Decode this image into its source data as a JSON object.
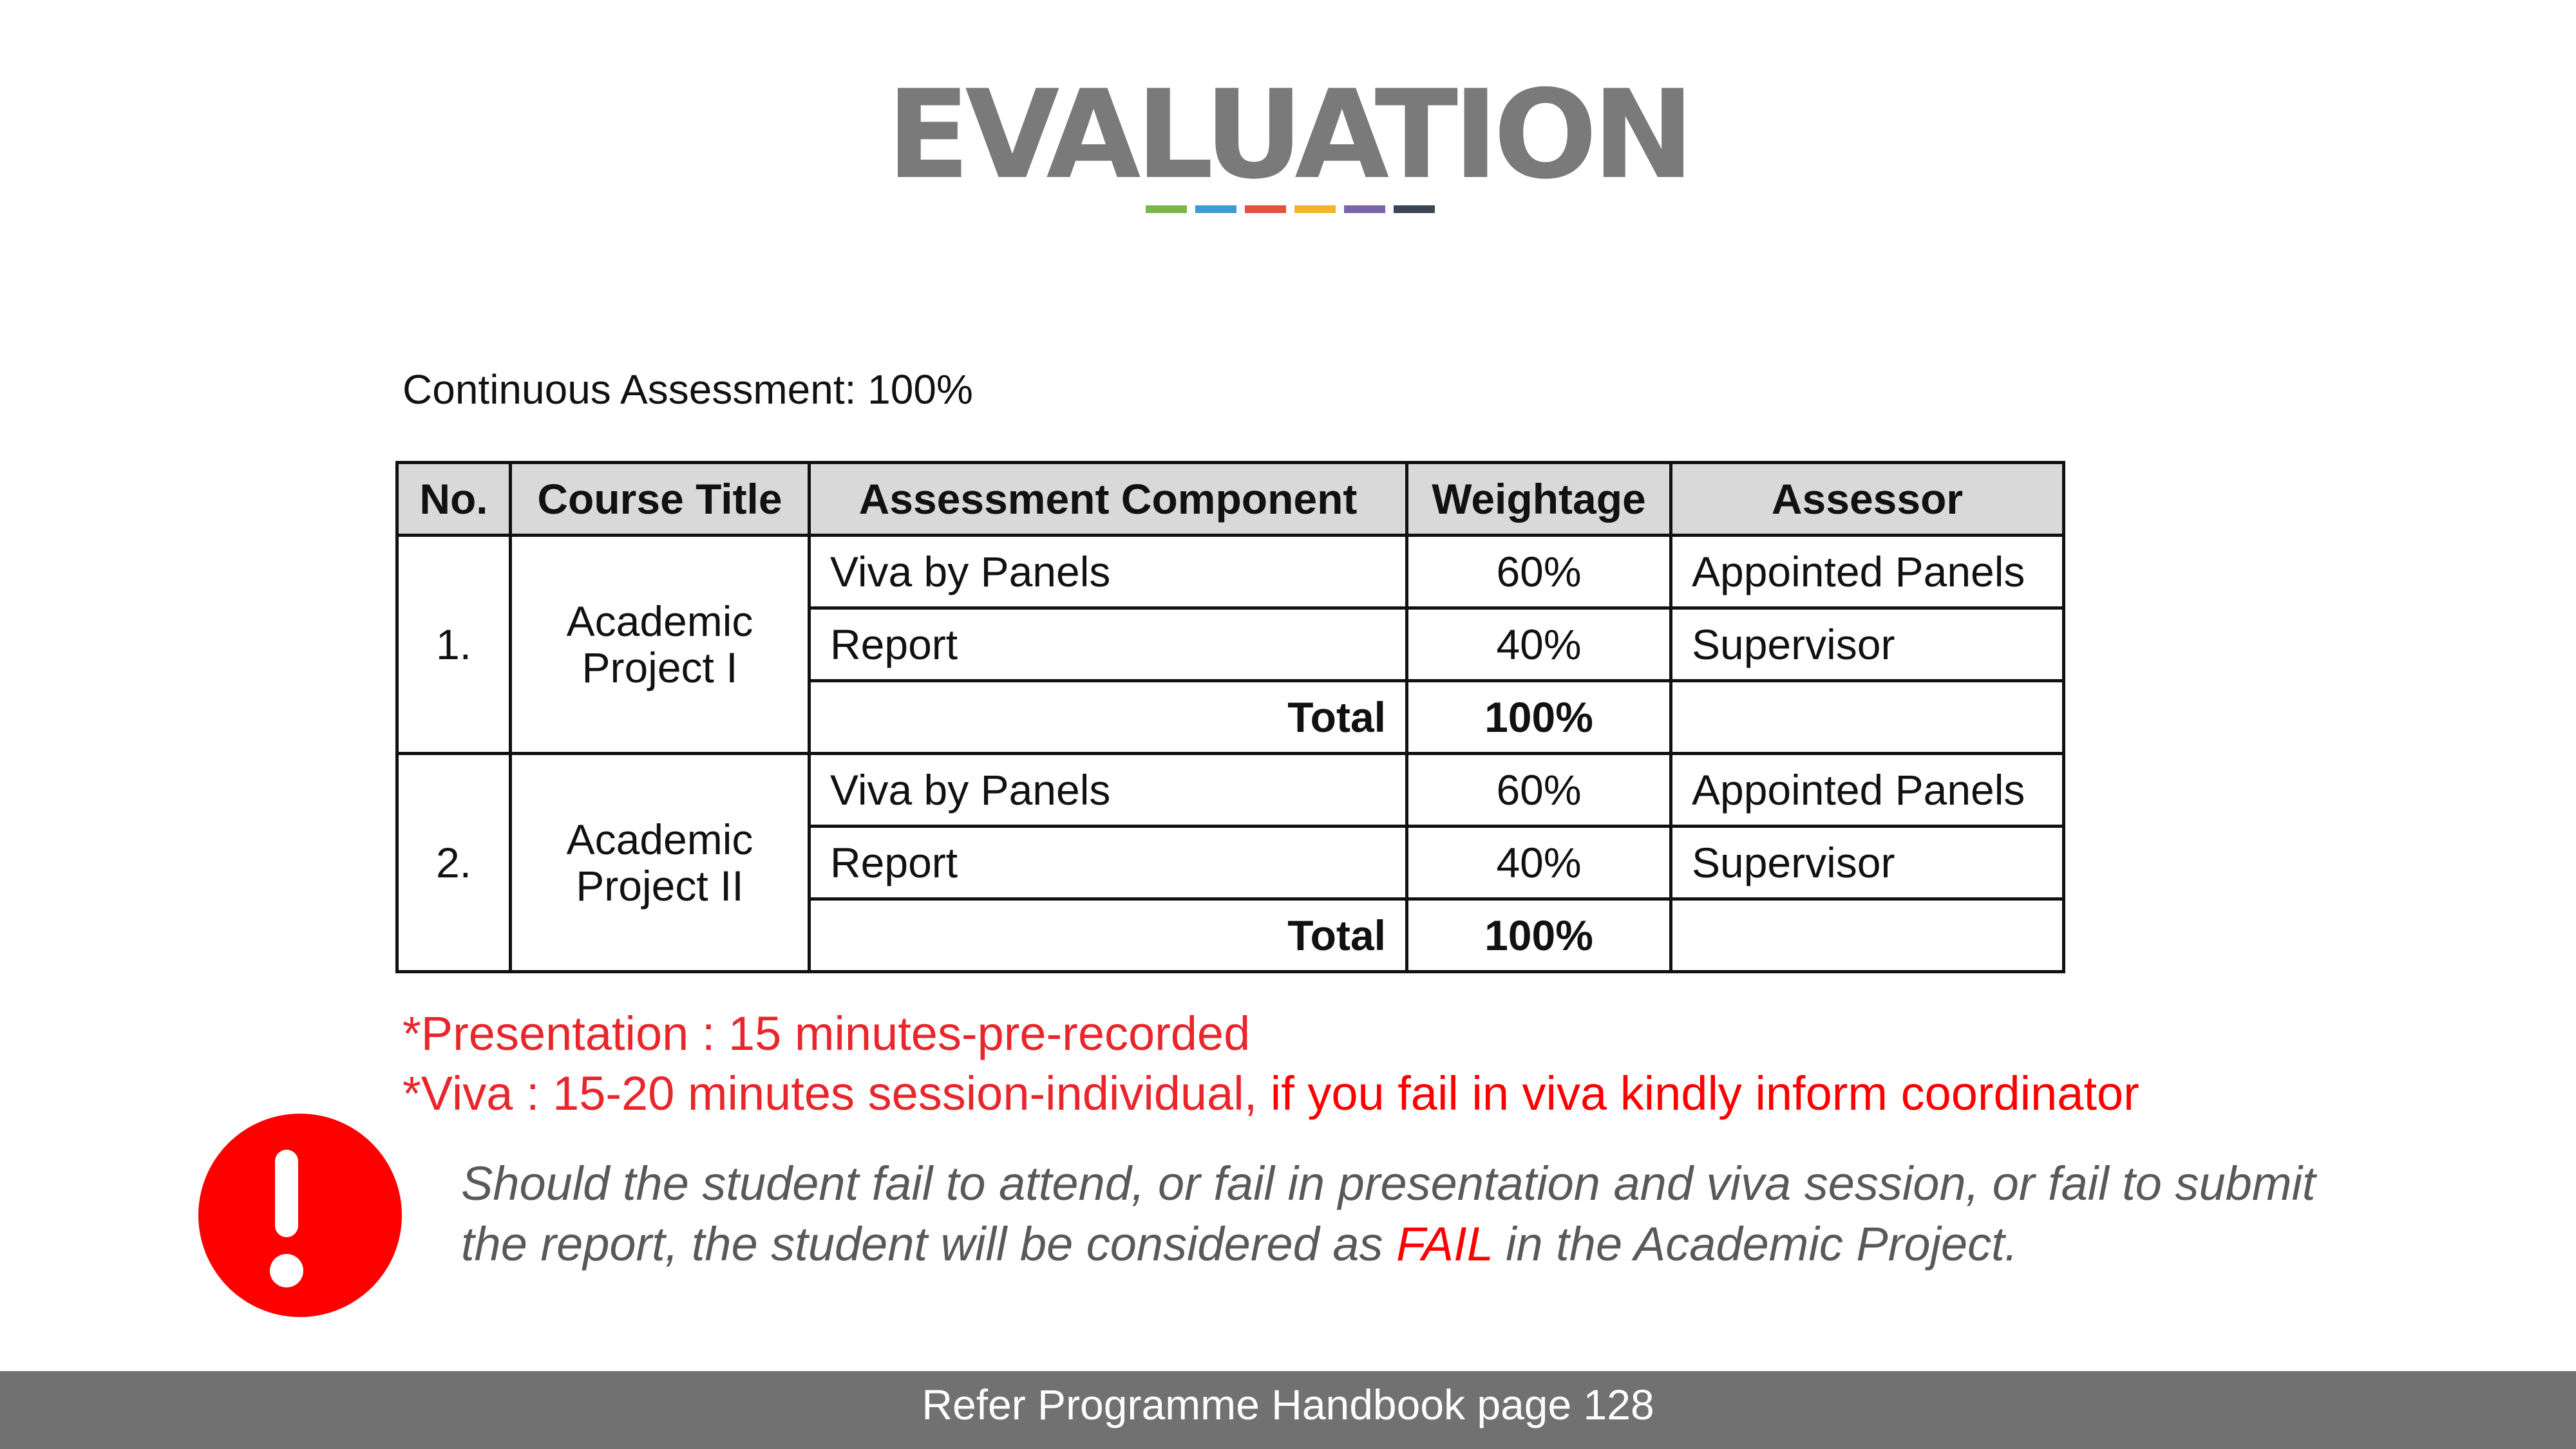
{
  "slide": {
    "title": "EVALUATION",
    "accent_colors": [
      "#7ab648",
      "#3f9ad6",
      "#e2523c",
      "#f3b42a",
      "#7b64a8",
      "#3a4556"
    ]
  },
  "assessment": {
    "label": "Continuous Assessment:  100%",
    "table": {
      "headers": [
        "No.",
        "Course Title",
        "Assessment Component",
        "Weightage",
        "Assessor"
      ],
      "courses": [
        {
          "no": "1.",
          "title": "Academic Project I",
          "components": [
            {
              "name": "Viva by Panels",
              "weight": "60%",
              "assessor": "Appointed Panels"
            },
            {
              "name": "Report",
              "weight": "40%",
              "assessor": "Supervisor"
            }
          ],
          "total_label": "Total",
          "total_value": "100%"
        },
        {
          "no": "2.",
          "title": "Academic Project II",
          "components": [
            {
              "name": "Viva by Panels",
              "weight": "60%",
              "assessor": "Appointed Panels"
            },
            {
              "name": "Report",
              "weight": "40%",
              "assessor": "Supervisor"
            }
          ],
          "total_label": "Total",
          "total_value": "100%"
        }
      ]
    }
  },
  "notes": {
    "presentation": "*Presentation : 15 minutes-pre-recorded",
    "viva": "*Viva : 15-20 minutes session-individual, ",
    "viva_emphasis": "if you fail in viva kindly inform coordinator"
  },
  "warning": {
    "icon": "exclamation-circle-icon",
    "text_before": "Should the student fail to attend, or fail in presentation and viva session, or fail to submit the report, the student will be considered as ",
    "fail_word": "FAIL",
    "text_after": " in the Academic Project."
  },
  "footer": {
    "text": "Refer Programme Handbook page 128"
  }
}
